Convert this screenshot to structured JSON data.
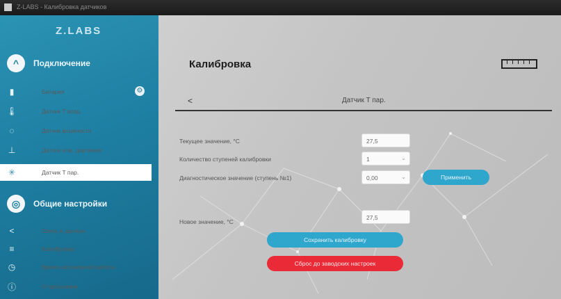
{
  "window": {
    "title": "Z-LABS - Калибровка датчиков"
  },
  "brand": {
    "logo_text": "Z.LABS"
  },
  "sidebar": {
    "connection": {
      "title": "Подключение",
      "icon": "chevron-up-icon"
    },
    "items": [
      {
        "label": "Батарея",
        "icon": "battery-icon"
      },
      {
        "label": "Датчик T возд.",
        "icon": "thermometer-icon"
      },
      {
        "label": "Датчик влажности",
        "icon": "humidity-icon"
      },
      {
        "label": "Датчик атм. давления",
        "icon": "pressure-icon"
      },
      {
        "label": "Датчик T пар.",
        "icon": "sensor-icon",
        "active": true
      }
    ],
    "settings": {
      "title": "Общие настройки",
      "icon": "settings-icon"
    },
    "settings_items": [
      {
        "label": "Связь и данные",
        "icon": "share-icon"
      },
      {
        "label": "Калибровка",
        "icon": "calibration-icon"
      },
      {
        "label": "Время автономной работы",
        "icon": "clock-icon"
      },
      {
        "label": "О программе",
        "icon": "info-icon"
      }
    ]
  },
  "main": {
    "title": "Калибровка",
    "subheader": {
      "back": "<",
      "title": "Датчик T пар."
    },
    "form": {
      "current_value_label": "Текущее значение, °C",
      "current_value": "27,5",
      "points_label": "Количество ступеней калибровки",
      "points_value": "1",
      "diag_label": "Диагностическое значение (ступень №1)",
      "diag_value": "0,00",
      "apply_label": "Применить",
      "new_value_label": "Новое значение, °C",
      "new_value": "27,5",
      "save_label": "Сохранить калибровку",
      "reset_label": "Сброс до заводских настроек"
    }
  },
  "colors": {
    "accent_blue": "#2fa6cc",
    "danger_red": "#ea2a37",
    "sidebar": "#1e7fa3"
  }
}
